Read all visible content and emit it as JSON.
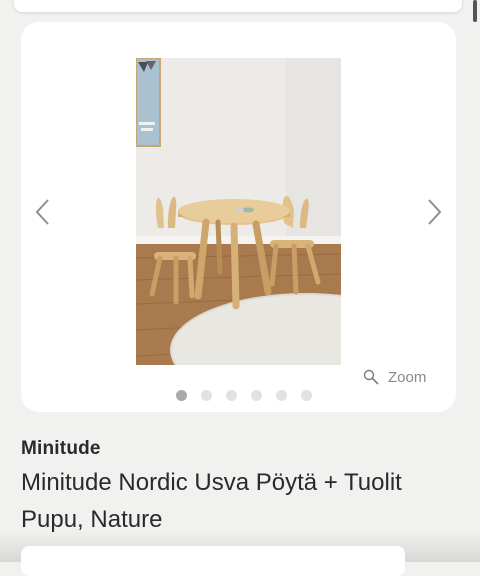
{
  "product": {
    "brand": "Minitude",
    "title": "Minitude Nordic Usva Pöytä + Tuolit Pupu, Nature"
  },
  "gallery": {
    "zoom_label": "Zoom",
    "slide_count": 6,
    "active_slide": 1,
    "image_subject": "wooden round table with two bunny-ear chairs"
  },
  "icons": {
    "prev": "chevron-left-icon",
    "next": "chevron-right-icon",
    "zoom": "magnifier-icon"
  },
  "colors": {
    "page_background": "#f1f1f0",
    "card_background": "#ffffff",
    "dot_active": "#a9a9a9",
    "dot_inactive": "#e2e2e2",
    "text_primary": "#2a2a2a"
  }
}
